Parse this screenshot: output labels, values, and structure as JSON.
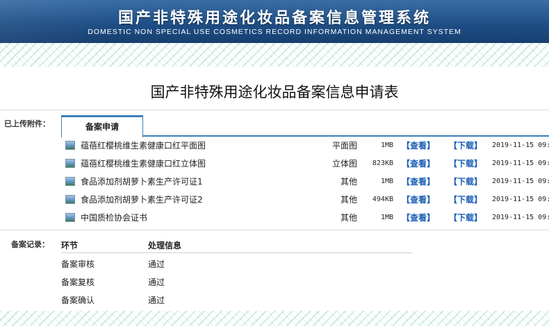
{
  "header": {
    "title": "国产非特殊用途化妆品备案信息管理系统",
    "subtitle": "DOMESTIC NON SPECIAL USE COSMETICS RECORD INFORMATION MANAGEMENT SYSTEM"
  },
  "form_title": "国产非特殊用途化妆品备案信息申请表",
  "attachments": {
    "label": "已上传附件：",
    "tab_label": "备案申请",
    "files": [
      {
        "name": "蕴蓓红樱桃维生素健康口红平面图",
        "type": "平面图",
        "size": "1MB",
        "view": "【查看】",
        "download": "【下载】",
        "date": "2019-11-15 09:"
      },
      {
        "name": "蕴蓓红樱桃维生素健康口红立体图",
        "type": "立体图",
        "size": "823KB",
        "view": "【查看】",
        "download": "【下载】",
        "date": "2019-11-15 09:"
      },
      {
        "name": "食品添加剂胡萝卜素生产许可证1",
        "type": "其他",
        "size": "1MB",
        "view": "【查看】",
        "download": "【下载】",
        "date": "2019-11-15 09:"
      },
      {
        "name": "食品添加剂胡萝卜素生产许可证2",
        "type": "其他",
        "size": "494KB",
        "view": "【查看】",
        "download": "【下载】",
        "date": "2019-11-15 09:"
      },
      {
        "name": "中国质检协会证书",
        "type": "其他",
        "size": "1MB",
        "view": "【查看】",
        "download": "【下载】",
        "date": "2019-11-15 09:"
      }
    ]
  },
  "records": {
    "label": "备案记录：",
    "headers": [
      "环节",
      "处理信息"
    ],
    "rows": [
      [
        "备案审核",
        "通过"
      ],
      [
        "备案复核",
        "通过"
      ],
      [
        "备案确认",
        "通过"
      ]
    ]
  },
  "colors": {
    "banner": "#1f4f86",
    "tab_border": "#3a7fb8",
    "link": "#1a5fb4"
  }
}
